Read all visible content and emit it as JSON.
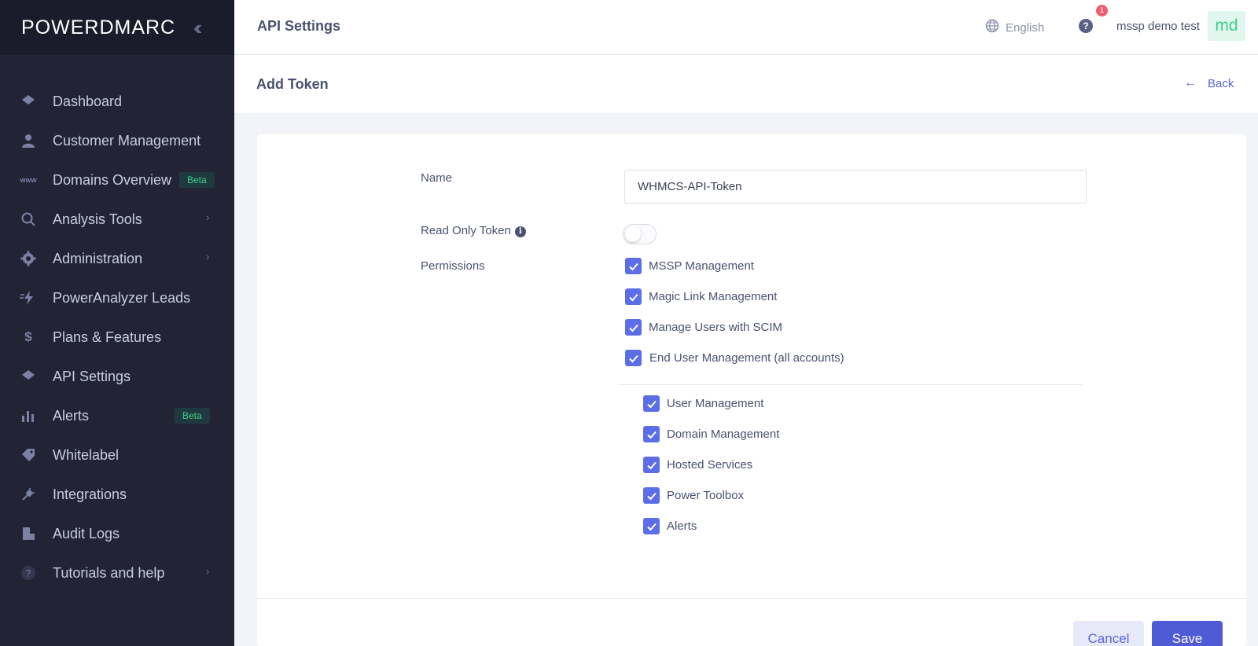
{
  "brand": {
    "logo": "POWERDMARC",
    "collapse_icon": "double-chevron-left"
  },
  "sidebar": {
    "items": [
      {
        "label": "Dashboard",
        "icon": "dashboard-icon"
      },
      {
        "label": "Customer Management",
        "icon": "user-icon"
      },
      {
        "label": "Domains Overview",
        "icon": "www-icon",
        "badge": "Beta"
      },
      {
        "label": "Analysis Tools",
        "icon": "search-icon",
        "chevron": true
      },
      {
        "label": "Administration",
        "icon": "gear-icon",
        "chevron": true
      },
      {
        "label": "PowerAnalyzer Leads",
        "icon": "bolt-icon"
      },
      {
        "label": "Plans & Features",
        "icon": "dollar-icon"
      },
      {
        "label": "API Settings",
        "icon": "api-icon"
      },
      {
        "label": "Alerts",
        "icon": "bar-chart-icon",
        "badge": "Beta"
      },
      {
        "label": "Whitelabel",
        "icon": "tag-icon"
      },
      {
        "label": "Integrations",
        "icon": "plug-icon"
      },
      {
        "label": "Audit Logs",
        "icon": "logs-icon"
      },
      {
        "label": "Tutorials and help",
        "icon": "question-icon",
        "chevron": true
      }
    ]
  },
  "header": {
    "title": "API Settings",
    "language": "English",
    "help": "?",
    "notification_count": "1",
    "user_name": "mssp demo test",
    "avatar_initials": "md"
  },
  "subheader": {
    "title": "Add Token",
    "back_label": "Back"
  },
  "form": {
    "name_label": "Name",
    "name_value": "WHMCS-API-Token",
    "read_only_label": "Read Only Token",
    "read_only_info": "i",
    "read_only_enabled": false,
    "permissions_label": "Permissions",
    "permissions": [
      {
        "label": "MSSP Management",
        "checked": true
      },
      {
        "label": "Magic Link Management",
        "checked": true
      },
      {
        "label": "Manage Users with SCIM",
        "checked": true
      },
      {
        "label": "End User Management (all accounts)",
        "checked": true
      }
    ],
    "sub_permissions": [
      {
        "label": "User Management",
        "checked": true
      },
      {
        "label": "Domain Management",
        "checked": true
      },
      {
        "label": "Hosted Services",
        "checked": true
      },
      {
        "label": "Power Toolbox",
        "checked": true
      },
      {
        "label": "Alerts",
        "checked": true
      }
    ],
    "cancel_label": "Cancel",
    "save_label": "Save"
  },
  "colors": {
    "sidebar_bg": "#222436",
    "accent": "#5b63d9",
    "checkbox": "#5b6ee8",
    "beta_badge": "#3ecf8e",
    "notification": "#f15c6d"
  }
}
